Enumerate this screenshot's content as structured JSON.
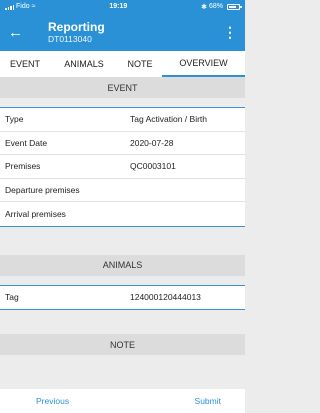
{
  "status_bar": {
    "carrier": "Fido",
    "time": "19:19",
    "battery": "68%"
  },
  "app_bar": {
    "back_icon": "arrow-left",
    "title": "Reporting",
    "subtitle": "DT0113040",
    "menu_icon": "more-vertical"
  },
  "tabs": [
    {
      "label": "EVENT"
    },
    {
      "label": "ANIMALS"
    },
    {
      "label": "NOTE"
    },
    {
      "label": "OVERVIEW",
      "active": true
    }
  ],
  "event_section": {
    "header": "EVENT",
    "rows": [
      {
        "label": "Type",
        "value": "Tag Activation / Birth"
      },
      {
        "label": "Event Date",
        "value": "2020-07-28"
      },
      {
        "label": "Premises",
        "value": "QC0003101"
      },
      {
        "label": "Departure premises",
        "value": ""
      },
      {
        "label": "Arrival premises",
        "value": ""
      }
    ]
  },
  "animals_section": {
    "header": "ANIMALS",
    "rows": [
      {
        "label": "Tag",
        "value": "124000120444013"
      }
    ]
  },
  "note_section": {
    "header": "NOTE"
  },
  "footer": {
    "previous_label": "Previous",
    "submit_label": "Submit"
  },
  "colors": {
    "primary": "#2b91d6",
    "section_bg": "#dcdcdc"
  }
}
